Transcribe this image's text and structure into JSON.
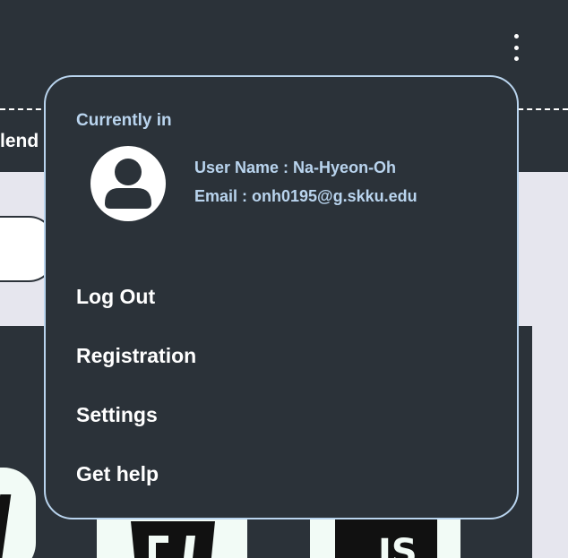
{
  "header": {
    "partial_tab_text": "lend",
    "more_menu_icon": "kebab-vertical-icon"
  },
  "account_menu": {
    "heading": "Currently in",
    "avatar_icon": "user-avatar-icon",
    "user_name": "User Name : Na-Hyeon-Oh",
    "email": "Email : onh0195@g.skku.edu",
    "items": [
      {
        "label": "Log Out"
      },
      {
        "label": "Registration"
      },
      {
        "label": "Settings"
      },
      {
        "label": "Get help"
      }
    ]
  },
  "background_logos": {
    "mid_logo_icon": "framework-logo-icon",
    "right_logo_text": "JS"
  },
  "colors": {
    "header_bg": "#2b3239",
    "menu_bg": "#2b3239",
    "menu_border": "#b9d4ee",
    "accent_text": "#b9d4ee",
    "page_bg": "#e6e6ee"
  }
}
